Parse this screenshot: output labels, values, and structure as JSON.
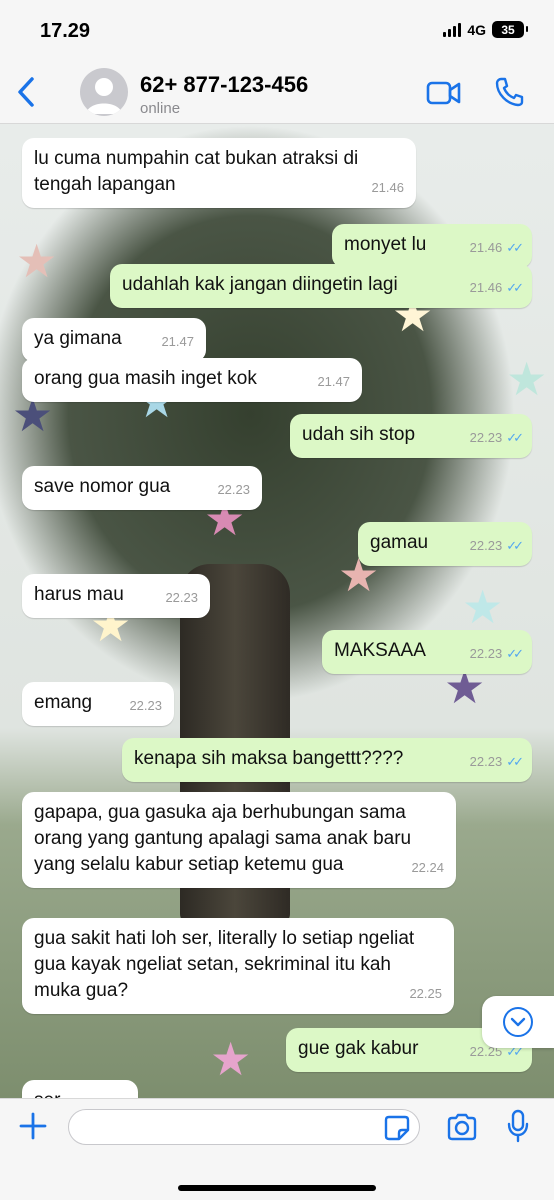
{
  "status_bar": {
    "time": "17.29",
    "network": "4G",
    "battery": "35"
  },
  "header": {
    "contact_name": "62+ 877-123-456",
    "contact_status": "online"
  },
  "messages": [
    {
      "dir": "in",
      "text": "lu cuma numpahin cat bukan atraksi di tengah lapangan",
      "time": "21.46"
    },
    {
      "dir": "out",
      "text": "monyet lu",
      "time": "21.46"
    },
    {
      "dir": "out",
      "text": "udahlah kak jangan diingetin lagi",
      "time": "21.46"
    },
    {
      "dir": "in",
      "text": "ya gimana",
      "time": "21.47"
    },
    {
      "dir": "in",
      "text": "orang gua masih inget kok",
      "time": "21.47"
    },
    {
      "dir": "out",
      "text": "udah sih stop",
      "time": "22.23"
    },
    {
      "dir": "in",
      "text": "save nomor gua",
      "time": "22.23"
    },
    {
      "dir": "out",
      "text": "gamau",
      "time": "22.23"
    },
    {
      "dir": "in",
      "text": "harus mau",
      "time": "22.23"
    },
    {
      "dir": "out",
      "text": "MAKSAAA",
      "time": "22.23"
    },
    {
      "dir": "in",
      "text": "emang",
      "time": "22.23"
    },
    {
      "dir": "out",
      "text": "kenapa sih maksa bangettt????",
      "time": "22.23"
    },
    {
      "dir": "in",
      "text": "gapapa, gua gasuka aja berhubungan sama orang yang gantung apalagi sama anak baru yang selalu kabur setiap ketemu gua",
      "time": "22.24"
    },
    {
      "dir": "in",
      "text": "gua sakit hati loh ser, literally lo setiap ngeliat gua kayak ngeliat setan, sekriminal itu kah muka gua?",
      "time": "22.25"
    },
    {
      "dir": "out",
      "text": "gue gak kabur",
      "time": "22.25"
    },
    {
      "dir": "in",
      "text": "ser",
      "time": ""
    }
  ],
  "input": {
    "placeholder": ""
  },
  "icons": {
    "back": "chevron-left-icon",
    "video": "video-camera-icon",
    "call": "phone-icon",
    "plus": "plus-icon",
    "sticker": "sticker-icon",
    "camera": "camera-icon",
    "mic": "microphone-icon",
    "scroll": "chevron-down-icon"
  },
  "colors": {
    "accent": "#1a73e8",
    "outgoing": "#dcf8c6",
    "incoming": "#ffffff",
    "read_tick": "#53a6f0"
  }
}
